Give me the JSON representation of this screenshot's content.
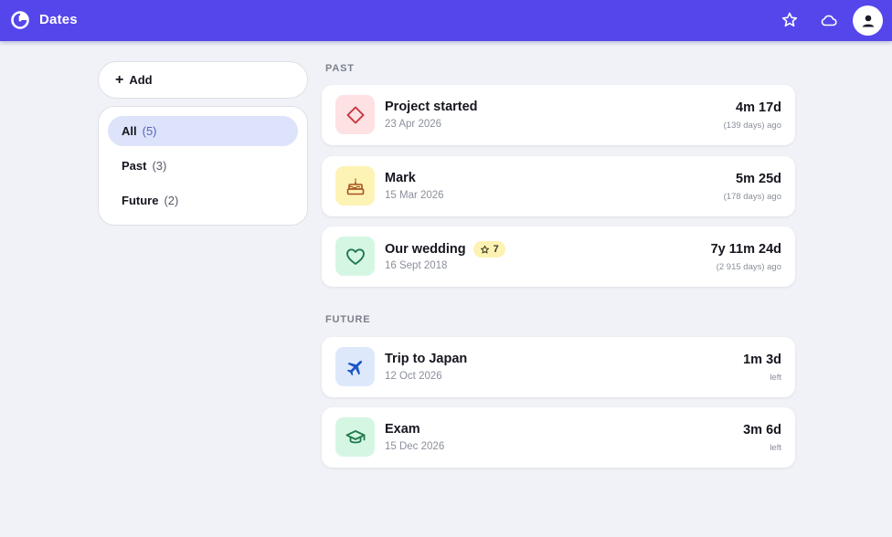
{
  "app": {
    "title": "Dates"
  },
  "sidebar": {
    "add_label": "Add",
    "filters": [
      {
        "name": "All",
        "count": "(5)"
      },
      {
        "name": "Past",
        "count": "(3)"
      },
      {
        "name": "Future",
        "count": "(2)"
      }
    ]
  },
  "sections": {
    "past_label": "PAST",
    "future_label": "FUTURE"
  },
  "past": [
    {
      "title": "Project started",
      "date": "23 Apr 2026",
      "duration": "4m 17d",
      "sub": "(139 days) ago",
      "icon": "diamond-icon",
      "icon_bg": "#fde1e3",
      "icon_color": "#c8353c"
    },
    {
      "title": "Mark",
      "date": "15 Mar 2026",
      "duration": "5m 25d",
      "sub": "(178 days) ago",
      "icon": "cake-icon",
      "icon_bg": "#fdf3b5",
      "icon_color": "#a6521d"
    },
    {
      "title": "Our wedding",
      "badge": "7",
      "date": "16 Sept 2018",
      "duration": "7y 11m 24d",
      "sub": "(2 915 days) ago",
      "icon": "heart-icon",
      "icon_bg": "#d5f6e3",
      "icon_color": "#1f7a4c"
    }
  ],
  "future": [
    {
      "title": "Trip to Japan",
      "date": "12 Oct 2026",
      "duration": "1m 3d",
      "sub": "left",
      "icon": "airplane-icon",
      "icon_bg": "#dde9fb",
      "icon_color": "#1c55c8"
    },
    {
      "title": "Exam",
      "date": "15 Dec 2026",
      "duration": "3m 6d",
      "sub": "left",
      "icon": "graduation-cap-icon",
      "icon_bg": "#d5f6e3",
      "icon_color": "#1f7a4c"
    }
  ],
  "colors": {
    "accent": "#5546ec",
    "active_filter": "#dde3fb",
    "background": "#f0f2f7"
  }
}
